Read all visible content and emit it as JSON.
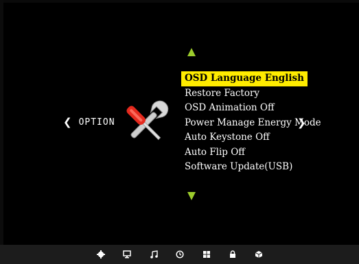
{
  "left_nav": {
    "arrow": "❮",
    "label": "OPTION"
  },
  "right_nav": {
    "arrow": "❯"
  },
  "menu": {
    "items": [
      {
        "label": "OSD Language English",
        "selected": true
      },
      {
        "label": "Restore Factory"
      },
      {
        "label": "OSD Animation Off"
      },
      {
        "label": "Power Manage Energy Mode"
      },
      {
        "label": "Auto Keystone Off"
      },
      {
        "label": "Auto Flip Off"
      },
      {
        "label": "Software Update(USB)"
      }
    ]
  },
  "colors": {
    "highlight": "#ffec00",
    "arrow_green": "#9ccc2c",
    "screwdriver_red": "#e52a1e",
    "bottom_bar": "#1c1c1c"
  },
  "bottom_tabs": [
    {
      "icon": "gear-icon"
    },
    {
      "icon": "monitor-icon"
    },
    {
      "icon": "music-note-icon"
    },
    {
      "icon": "clock-icon"
    },
    {
      "icon": "grid-icon"
    },
    {
      "icon": "lock-icon"
    },
    {
      "icon": "box-icon"
    }
  ]
}
